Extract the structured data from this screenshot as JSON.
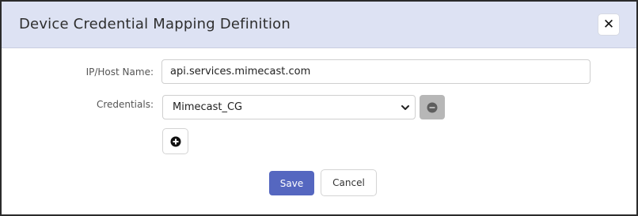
{
  "dialog": {
    "title": "Device Credential Mapping Definition",
    "close_icon": "close-icon"
  },
  "form": {
    "host_label": "IP/Host Name:",
    "host_value": "api.services.mimecast.com",
    "credentials_label": "Credentials:",
    "credentials_selected": "Mimecast_CG",
    "remove_icon": "minus-circle-icon",
    "add_icon": "plus-circle-icon"
  },
  "actions": {
    "save_label": "Save",
    "cancel_label": "Cancel"
  },
  "colors": {
    "header_bg": "#dde2f3",
    "save_bg": "#5567c0",
    "remove_bg": "#b7b7b7"
  }
}
